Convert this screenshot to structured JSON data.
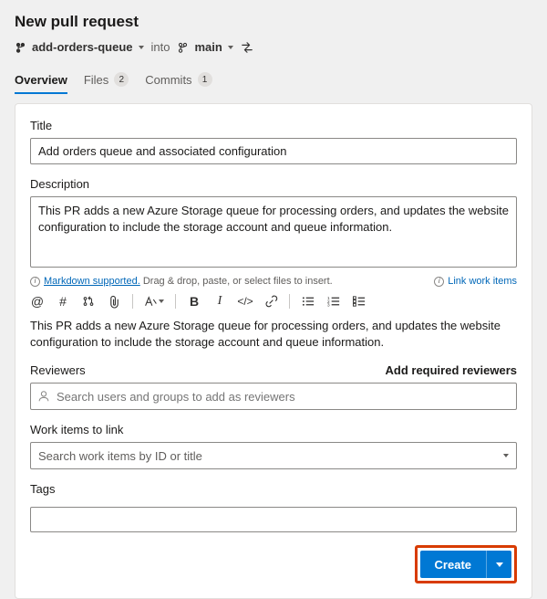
{
  "header": {
    "page_title": "New pull request",
    "source_branch": "add-orders-queue",
    "into_label": "into",
    "target_branch": "main"
  },
  "tabs": {
    "overview": "Overview",
    "files": {
      "label": "Files",
      "count": "2"
    },
    "commits": {
      "label": "Commits",
      "count": "1"
    }
  },
  "form": {
    "title_label": "Title",
    "title_value": "Add orders queue and associated configuration",
    "description_label": "Description",
    "description_value": "This PR adds a new Azure Storage queue for processing orders, and updates the website configuration to include the storage account and queue information.",
    "markdown_hint_link": "Markdown supported.",
    "markdown_hint_rest": " Drag & drop, paste, or select files to insert.",
    "link_work_items": "Link work items",
    "preview_text": "This PR adds a new Azure Storage queue for processing orders, and updates the website configuration to include the storage account and queue information.",
    "reviewers_label": "Reviewers",
    "add_required_reviewers": "Add required reviewers",
    "reviewers_placeholder": "Search users and groups to add as reviewers",
    "work_items_label": "Work items to link",
    "work_items_placeholder": "Search work items by ID or title",
    "tags_label": "Tags",
    "create_button": "Create"
  },
  "toolbar_icons": [
    "mention-icon",
    "hashtag-icon",
    "pull-request-icon",
    "attachment-icon",
    "text-style-icon",
    "bold-icon",
    "italic-icon",
    "code-icon",
    "link-icon",
    "bullet-list-icon",
    "numbered-list-icon",
    "checklist-icon"
  ]
}
